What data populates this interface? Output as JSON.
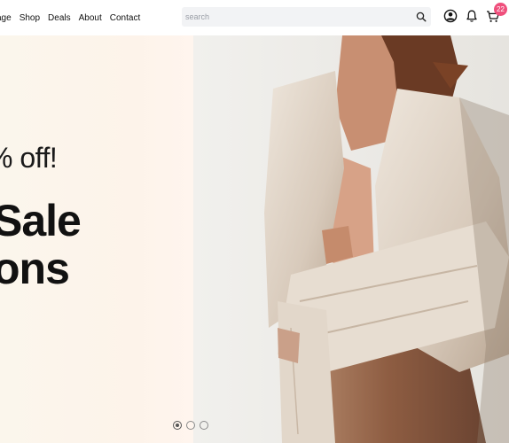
{
  "nav": {
    "items": [
      "age",
      "Shop",
      "Deals",
      "About",
      "Contact"
    ]
  },
  "search": {
    "placeholder": "search"
  },
  "header": {
    "cart_count": "22",
    "icons": [
      "search-icon",
      "user-icon",
      "bell-icon",
      "cart-icon"
    ]
  },
  "hero": {
    "subtitle": "% off!",
    "title_line1": "Sale",
    "title_line2": "ons",
    "slides": {
      "count": 3,
      "active": 1
    }
  },
  "colors": {
    "badge": "#ef4f7c",
    "search_bg": "#f2f3f5",
    "hero_left_bg": "#fcf5ec",
    "hero_image_bg": "#efeeeb"
  }
}
